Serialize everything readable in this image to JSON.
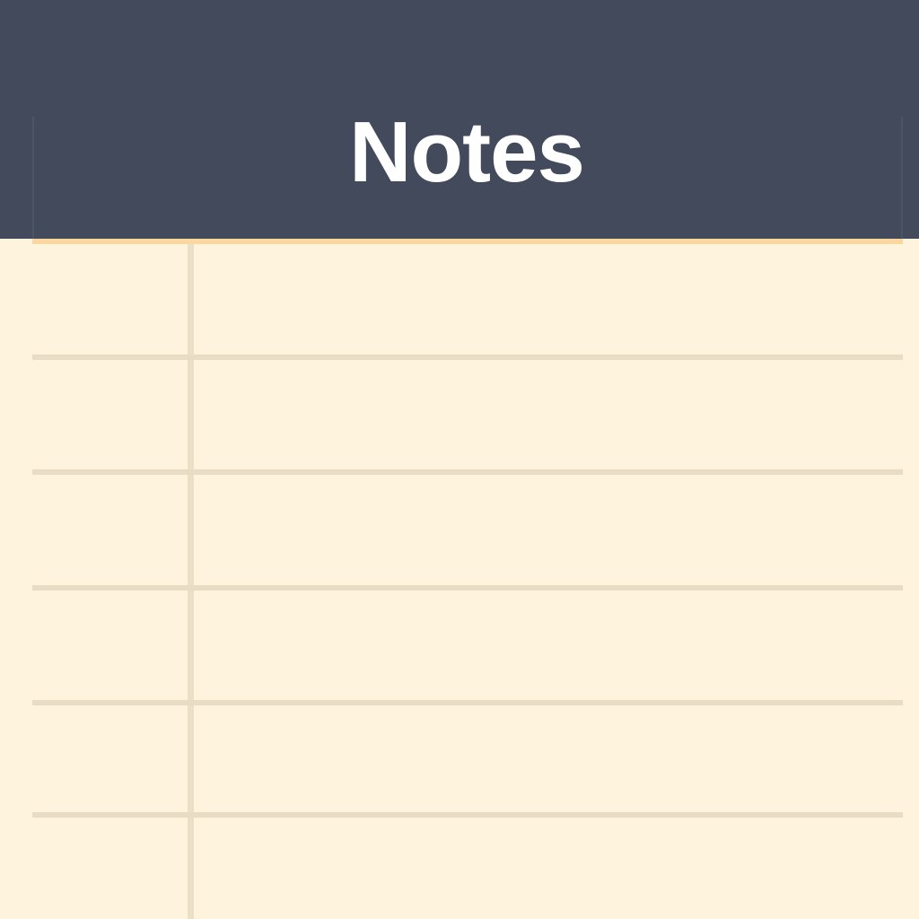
{
  "app": {
    "title": "Notes"
  },
  "colors": {
    "header": "#434a5c",
    "paper": "#fef3dc",
    "rule": "#e9dcc4",
    "accent": "#f9d79e",
    "title_text": "#ffffff"
  },
  "icons": {
    "page": "notepad-icon"
  }
}
